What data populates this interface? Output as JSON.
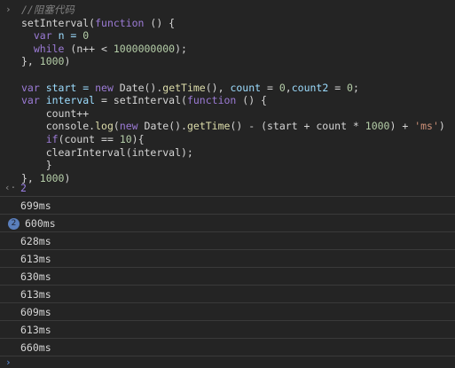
{
  "input": {
    "prompt_icon": "chevron-right-icon",
    "prompt_glyph": "›",
    "lines": [
      [
        {
          "t": "//阻塞代码",
          "c": "cm"
        }
      ],
      [
        {
          "t": "setInterval(",
          "c": "plain"
        },
        {
          "t": "function",
          "c": "kw2"
        },
        {
          "t": " () {",
          "c": "plain"
        }
      ],
      [
        {
          "t": "  ",
          "c": "plain"
        },
        {
          "t": "var",
          "c": "kw2"
        },
        {
          "t": " n = ",
          "c": "var"
        },
        {
          "t": "0",
          "c": "num"
        }
      ],
      [
        {
          "t": "  ",
          "c": "plain"
        },
        {
          "t": "while",
          "c": "kw2"
        },
        {
          "t": " (n++ < ",
          "c": "plain"
        },
        {
          "t": "1000000000",
          "c": "num"
        },
        {
          "t": ");",
          "c": "plain"
        }
      ],
      [
        {
          "t": "}, ",
          "c": "plain"
        },
        {
          "t": "1000",
          "c": "num"
        },
        {
          "t": ")",
          "c": "plain"
        }
      ],
      [
        {
          "t": "",
          "c": "plain"
        }
      ],
      [
        {
          "t": "var",
          "c": "kw2"
        },
        {
          "t": " start = ",
          "c": "var"
        },
        {
          "t": "new",
          "c": "kw2"
        },
        {
          "t": " Date().",
          "c": "plain"
        },
        {
          "t": "getTime",
          "c": "fn"
        },
        {
          "t": "(), ",
          "c": "plain"
        },
        {
          "t": "count",
          "c": "var"
        },
        {
          "t": " = ",
          "c": "plain"
        },
        {
          "t": "0",
          "c": "num"
        },
        {
          "t": ",",
          "c": "plain"
        },
        {
          "t": "count2",
          "c": "var"
        },
        {
          "t": " = ",
          "c": "plain"
        },
        {
          "t": "0",
          "c": "num"
        },
        {
          "t": ";",
          "c": "plain"
        }
      ],
      [
        {
          "t": "var",
          "c": "kw2"
        },
        {
          "t": " interval",
          "c": "var"
        },
        {
          "t": " = setInterval(",
          "c": "plain"
        },
        {
          "t": "function",
          "c": "kw2"
        },
        {
          "t": " () {",
          "c": "plain"
        }
      ],
      [
        {
          "t": "    count++",
          "c": "plain"
        }
      ],
      [
        {
          "t": "    console.",
          "c": "plain"
        },
        {
          "t": "log",
          "c": "fn"
        },
        {
          "t": "(",
          "c": "plain"
        },
        {
          "t": "new",
          "c": "kw2"
        },
        {
          "t": " Date().",
          "c": "plain"
        },
        {
          "t": "getTime",
          "c": "fn"
        },
        {
          "t": "() - (start + count * ",
          "c": "plain"
        },
        {
          "t": "1000",
          "c": "num"
        },
        {
          "t": ") + ",
          "c": "plain"
        },
        {
          "t": "'ms'",
          "c": "str"
        },
        {
          "t": ")",
          "c": "plain"
        }
      ],
      [
        {
          "t": "    ",
          "c": "plain"
        },
        {
          "t": "if",
          "c": "kw2"
        },
        {
          "t": "(count == ",
          "c": "plain"
        },
        {
          "t": "10",
          "c": "num"
        },
        {
          "t": "){",
          "c": "plain"
        }
      ],
      [
        {
          "t": "    clearInterval(interval);",
          "c": "plain"
        }
      ],
      [
        {
          "t": "    }",
          "c": "plain"
        }
      ],
      [
        {
          "t": "}, ",
          "c": "plain"
        },
        {
          "t": "1000",
          "c": "num"
        },
        {
          "t": ")",
          "c": "plain"
        }
      ]
    ]
  },
  "result": {
    "arrow_icon": "return-arrow-icon",
    "arrow_glyph": "‹·",
    "value": "2"
  },
  "logs": [
    {
      "text": "699ms",
      "repeat": ""
    },
    {
      "text": "600ms",
      "repeat": "2"
    },
    {
      "text": "628ms",
      "repeat": ""
    },
    {
      "text": "613ms",
      "repeat": ""
    },
    {
      "text": "630ms",
      "repeat": ""
    },
    {
      "text": "613ms",
      "repeat": ""
    },
    {
      "text": "609ms",
      "repeat": ""
    },
    {
      "text": "613ms",
      "repeat": ""
    },
    {
      "text": "660ms",
      "repeat": ""
    }
  ],
  "bottom_prompt": {
    "icon": "chevron-right-icon",
    "glyph": "›"
  }
}
